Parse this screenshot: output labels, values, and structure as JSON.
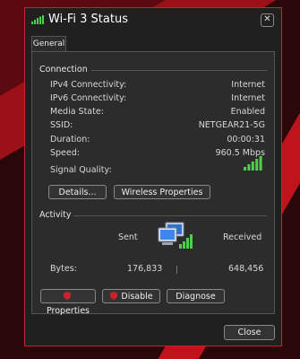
{
  "window": {
    "title": "Wi-Fi 3 Status"
  },
  "tabs": [
    {
      "label": "General"
    }
  ],
  "connection": {
    "heading": "Connection",
    "rows": [
      {
        "label": "IPv4 Connectivity:",
        "value": "Internet"
      },
      {
        "label": "IPv6 Connectivity:",
        "value": "Internet"
      },
      {
        "label": "Media State:",
        "value": "Enabled"
      },
      {
        "label": "SSID:",
        "value": "NETGEAR21-5G"
      },
      {
        "label": "Duration:",
        "value": "00:00:31"
      },
      {
        "label": "Speed:",
        "value": "960.5 Mbps"
      }
    ],
    "signal_label": "Signal Quality:",
    "signal_bars_filled": 5,
    "details_button": "Details...",
    "wireless_button": "Wireless Properties"
  },
  "activity": {
    "heading": "Activity",
    "sent_label": "Sent",
    "received_label": "Received",
    "bytes_label": "Bytes:",
    "bytes_sent": "176,833",
    "bytes_received": "648,456"
  },
  "actions": {
    "properties": "Properties",
    "disable": "Disable",
    "diagnose": "Diagnose"
  },
  "footer": {
    "close_button": "Close"
  },
  "colors": {
    "accent": "#c8232c",
    "signal": "#4bd14b"
  }
}
